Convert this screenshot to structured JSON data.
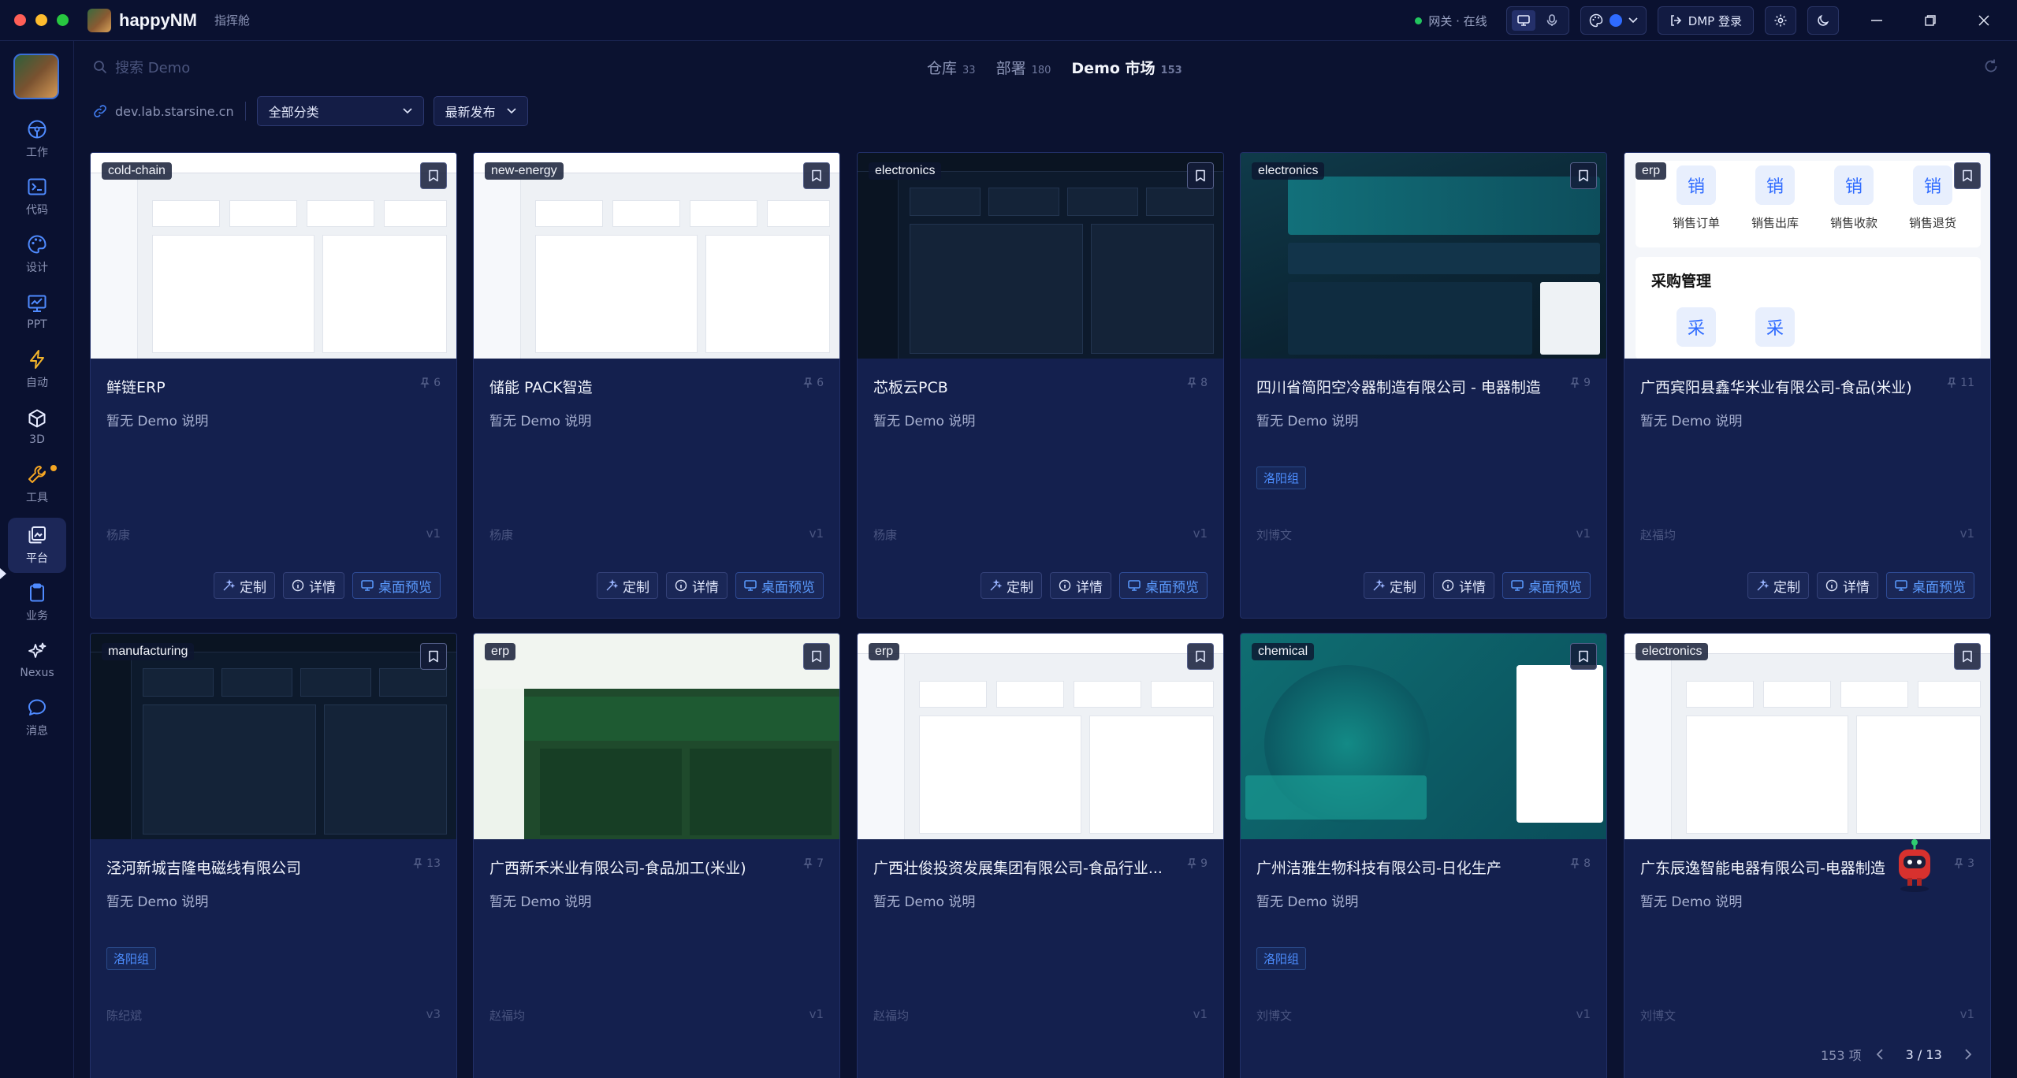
{
  "app": {
    "name": "happyNM",
    "subtitle": "指挥舱"
  },
  "topbar": {
    "gateway_label": "网关 · 在线",
    "login_label": "DMP 登录",
    "accent_color": "#2f6bff"
  },
  "sidebar": {
    "items": [
      {
        "label": "工作",
        "icon": "steering-icon"
      },
      {
        "label": "代码",
        "icon": "terminal-icon"
      },
      {
        "label": "设计",
        "icon": "palette-icon"
      },
      {
        "label": "PPT",
        "icon": "presentation-icon"
      },
      {
        "label": "自动",
        "icon": "lightning-icon"
      },
      {
        "label": "3D",
        "icon": "cube-icon"
      },
      {
        "label": "工具",
        "icon": "wrench-icon"
      },
      {
        "label": "平台",
        "icon": "platform-icon"
      },
      {
        "label": "业务",
        "icon": "clipboard-icon"
      },
      {
        "label": "Nexus",
        "icon": "sparkle-icon"
      },
      {
        "label": "消息",
        "icon": "chat-icon"
      }
    ]
  },
  "search": {
    "placeholder": "搜索 Demo"
  },
  "tabs": [
    {
      "label": "仓库",
      "count": "33"
    },
    {
      "label": "部署",
      "count": "180"
    },
    {
      "label": "Demo 市场",
      "count": "153"
    }
  ],
  "filters": {
    "host": "dev.lab.starsine.cn",
    "category": "全部分类",
    "sort": "最新发布"
  },
  "card_actions": {
    "customize": "定制",
    "details": "详情",
    "preview": "桌面预览"
  },
  "cards": [
    {
      "tag": "cold-chain",
      "title": "鲜链ERP",
      "count": "6",
      "desc": "暂无 Demo 说明",
      "group": "",
      "author": "杨康",
      "version": "v1"
    },
    {
      "tag": "new-energy",
      "title": "储能 PACK智造",
      "count": "6",
      "desc": "暂无 Demo 说明",
      "group": "",
      "author": "杨康",
      "version": "v1"
    },
    {
      "tag": "electronics",
      "title": "芯板云PCB",
      "count": "8",
      "desc": "暂无 Demo 说明",
      "group": "",
      "author": "杨康",
      "version": "v1"
    },
    {
      "tag": "electronics",
      "title": "四川省简阳空冷器制造有限公司 - 电器制造",
      "count": "9",
      "desc": "暂无 Demo 说明",
      "group": "洛阳组",
      "author": "刘博文",
      "version": "v1"
    },
    {
      "tag": "erp",
      "title": "广西宾阳县鑫华米业有限公司-食品(米业)",
      "count": "11",
      "desc": "暂无 Demo 说明",
      "group": "",
      "author": "赵福均",
      "version": "v1",
      "thumb_labels": [
        "销售订单",
        "销售出库",
        "销售收款",
        "销售退货",
        "采购管理",
        "销",
        "采"
      ]
    },
    {
      "tag": "manufacturing",
      "title": "泾河新城吉隆电磁线有限公司",
      "count": "13",
      "desc": "暂无 Demo 说明",
      "group": "洛阳组",
      "author": "陈纪斌",
      "version": "v3"
    },
    {
      "tag": "erp",
      "title": "广西新禾米业有限公司-食品加工(米业)",
      "count": "7",
      "desc": "暂无 Demo 说明",
      "group": "",
      "author": "赵福均",
      "version": "v1"
    },
    {
      "tag": "erp",
      "title": "广西壮俊投资发展集团有限公司-食品行业...",
      "count": "9",
      "desc": "暂无 Demo 说明",
      "group": "",
      "author": "赵福均",
      "version": "v1"
    },
    {
      "tag": "chemical",
      "title": "广州洁雅生物科技有限公司-日化生产",
      "count": "8",
      "desc": "暂无 Demo 说明",
      "group": "洛阳组",
      "author": "刘博文",
      "version": "v1"
    },
    {
      "tag": "electronics",
      "title": "广东辰逸智能电器有限公司-电器制造",
      "count": "3",
      "desc": "暂无 Demo 说明",
      "group": "",
      "author": "刘博文",
      "version": "v1"
    }
  ],
  "footer": {
    "total": "153 项",
    "page": "3 / 13"
  }
}
